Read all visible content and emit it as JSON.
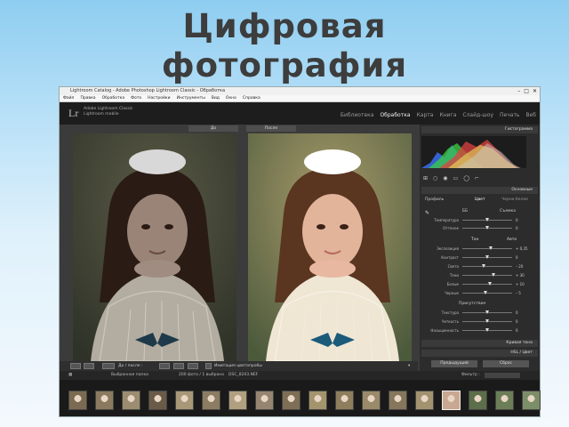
{
  "slide": {
    "title_line1": "Цифровая",
    "title_line2": "фотография"
  },
  "window": {
    "title": "Lightroom Catalog - Adobe Photoshop Lightroom Classic - Обработка",
    "controls": [
      "–",
      "□",
      "✕"
    ]
  },
  "menu": [
    "Файл",
    "Правка",
    "Обработка",
    "Фото",
    "Настройки",
    "Инструменты",
    "Вид",
    "Окно",
    "Справка"
  ],
  "identity": {
    "logo": "Lr",
    "line1": "Adobe Lightroom Classic",
    "line2": "Lightroom mobile"
  },
  "modules": [
    {
      "label": "Библиотека",
      "active": false
    },
    {
      "label": "Обработка",
      "active": true
    },
    {
      "label": "Карта",
      "active": false
    },
    {
      "label": "Книга",
      "active": false
    },
    {
      "label": "Слайд-шоу",
      "active": false
    },
    {
      "label": "Печать",
      "active": false
    },
    {
      "label": "Веб",
      "active": false
    }
  ],
  "view": {
    "before_label": "До",
    "after_label": "После"
  },
  "toolstrip": {
    "mode": "До / после :",
    "softproof": "Имитация цветопробы"
  },
  "panel": {
    "histogram_title": "Гистограмма",
    "basic_title": "Основные",
    "treatment": "Цвет",
    "bw": "Черно-белое",
    "profile": "Профиль",
    "wb_label": "ББ",
    "wb_value": "Съемка",
    "tone_label": "Тон",
    "tone_auto": "Авто",
    "presence_label": "Присутствие",
    "sliders_wb": [
      {
        "label": "Температура",
        "value": "0",
        "pos": 0.5
      },
      {
        "label": "Оттенок",
        "value": "0",
        "pos": 0.5
      }
    ],
    "sliders_tone": [
      {
        "label": "Экспозиция",
        "value": "+ 0,35",
        "pos": 0.58
      },
      {
        "label": "Контраст",
        "value": "0",
        "pos": 0.5
      },
      {
        "label": "Света",
        "value": "– 20",
        "pos": 0.42
      },
      {
        "label": "Тени",
        "value": "+ 30",
        "pos": 0.63
      },
      {
        "label": "Белые",
        "value": "+ 10",
        "pos": 0.55
      },
      {
        "label": "Черные",
        "value": "– 5",
        "pos": 0.47
      }
    ],
    "sliders_presence": [
      {
        "label": "Текстура",
        "value": "0",
        "pos": 0.5
      },
      {
        "label": "Четкость",
        "value": "0",
        "pos": 0.5
      },
      {
        "label": "Насыщенность",
        "value": "0",
        "pos": 0.5
      }
    ],
    "tone_curve": "Кривая тона",
    "hsl": "HSL / Цвет",
    "prev_btn": "Предыдущий",
    "reset_btn": "Сброс"
  },
  "filmstrip": {
    "source": "Выбранная папка",
    "count": "200 фото / 1 выбрано",
    "file": "DSC_8203.NEF",
    "filter": "Фильтр :",
    "thumbs": 18,
    "selected_index": 14
  },
  "colors": {
    "accent": "#f2f2f2",
    "panel": "#2c2c2c",
    "bg_top": "#8ecdf0"
  }
}
